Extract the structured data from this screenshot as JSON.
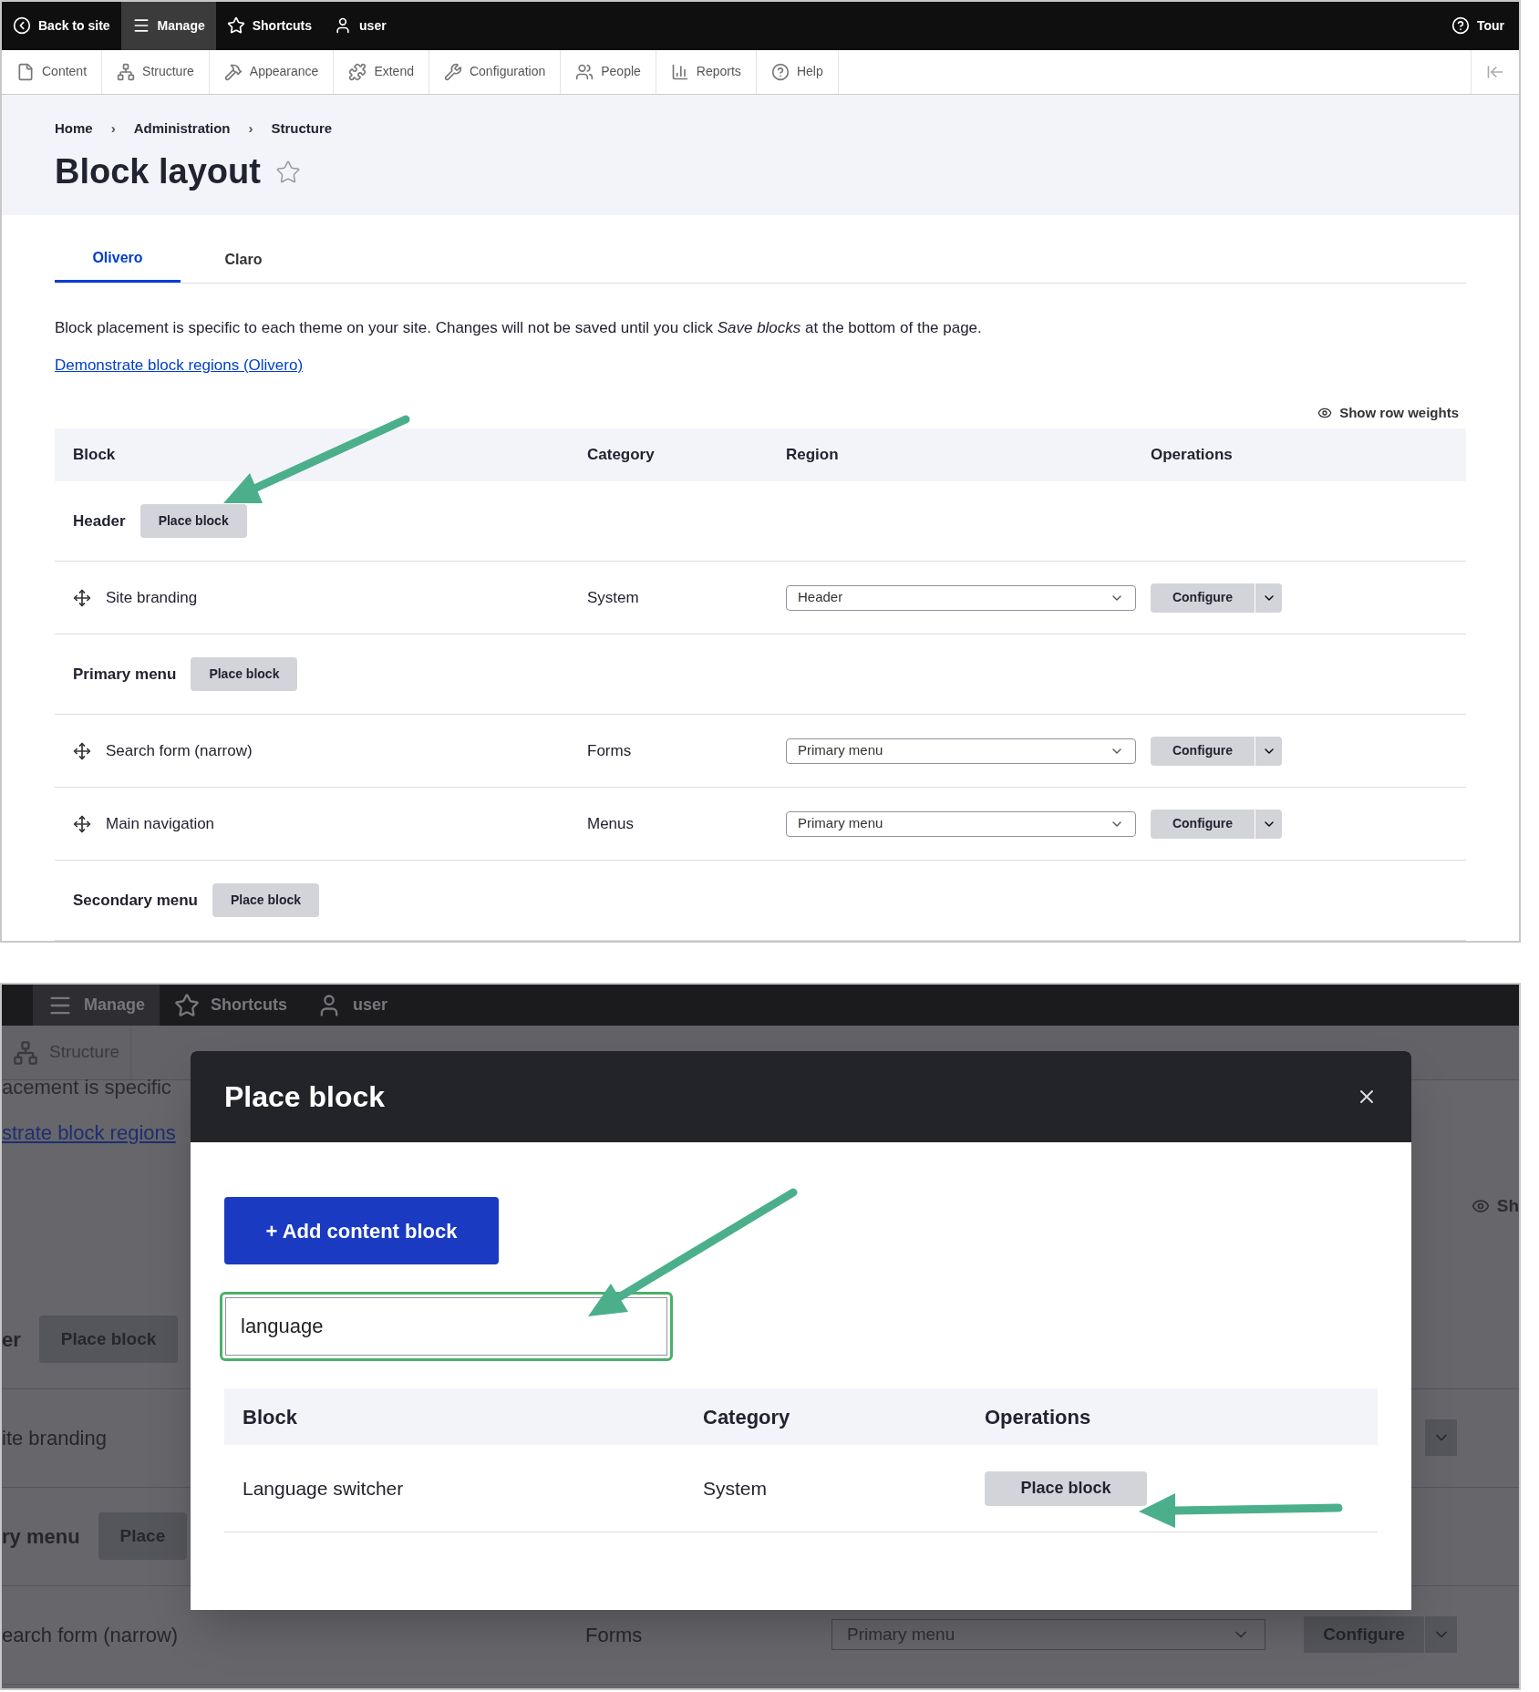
{
  "top": {
    "toolbar": {
      "items": [
        {
          "label": "Back to site",
          "selected": false
        },
        {
          "label": "Manage",
          "selected": true
        },
        {
          "label": "Shortcuts",
          "selected": false
        },
        {
          "label": "user",
          "selected": false
        }
      ],
      "tour": "Tour"
    },
    "admin_menu": [
      "Content",
      "Structure",
      "Appearance",
      "Extend",
      "Configuration",
      "People",
      "Reports",
      "Help"
    ],
    "breadcrumb": [
      "Home",
      "Administration",
      "Structure"
    ],
    "breadcrumb_separator": "›",
    "title": "Block layout",
    "tabs": [
      {
        "label": "Olivero",
        "selected": true
      },
      {
        "label": "Claro",
        "selected": false
      }
    ],
    "description": "Block placement is specific to each theme on your site. Changes will not be saved until you click *Save blocks* at the bottom of the page.",
    "demo_link": "Demonstrate block regions (Olivero)",
    "show_row_weights": "Show row weights",
    "table": {
      "columns": [
        "Block",
        "Category",
        "Region",
        "Operations"
      ],
      "rows": [
        {
          "kind": "region",
          "label": "Header",
          "button": "Place block"
        },
        {
          "kind": "block",
          "name": "Site branding",
          "category": "System",
          "region": "Header",
          "operation": "Configure"
        },
        {
          "kind": "region",
          "label": "Primary menu",
          "button": "Place block"
        },
        {
          "kind": "block",
          "name": "Search form (narrow)",
          "category": "Forms",
          "region": "Primary menu",
          "operation": "Configure"
        },
        {
          "kind": "block",
          "name": "Main navigation",
          "category": "Menus",
          "region": "Primary menu",
          "operation": "Configure"
        },
        {
          "kind": "region",
          "label": "Secondary menu",
          "button": "Place block"
        }
      ]
    }
  },
  "bottom": {
    "toolbar": {
      "items": [
        {
          "label": "Manage",
          "selected": true
        },
        {
          "label": "Shortcuts",
          "selected": false
        },
        {
          "label": "user",
          "selected": false
        }
      ]
    },
    "admin_menu": [
      "Structure"
    ],
    "description": "acement is specific",
    "demo_link": "strate block regions",
    "show_row_weights": "Sh",
    "rows": [
      {
        "kind": "region",
        "label": "er",
        "button": "Place block"
      },
      {
        "kind": "block",
        "name": "ite branding"
      },
      {
        "kind": "region",
        "label": "ry menu",
        "button": "Place"
      },
      {
        "kind": "block",
        "name": "earch form (narrow)",
        "category": "Forms",
        "region": "Primary menu",
        "operation": "Configure"
      }
    ],
    "dialog": {
      "title": "Place block",
      "add_button": "+ Add content block",
      "search": {
        "value": "language"
      },
      "table": {
        "columns": [
          "Block",
          "Category",
          "Operations"
        ],
        "rows": [
          {
            "block": "Language switcher",
            "category": "System",
            "operation": "Place block"
          }
        ]
      }
    }
  }
}
